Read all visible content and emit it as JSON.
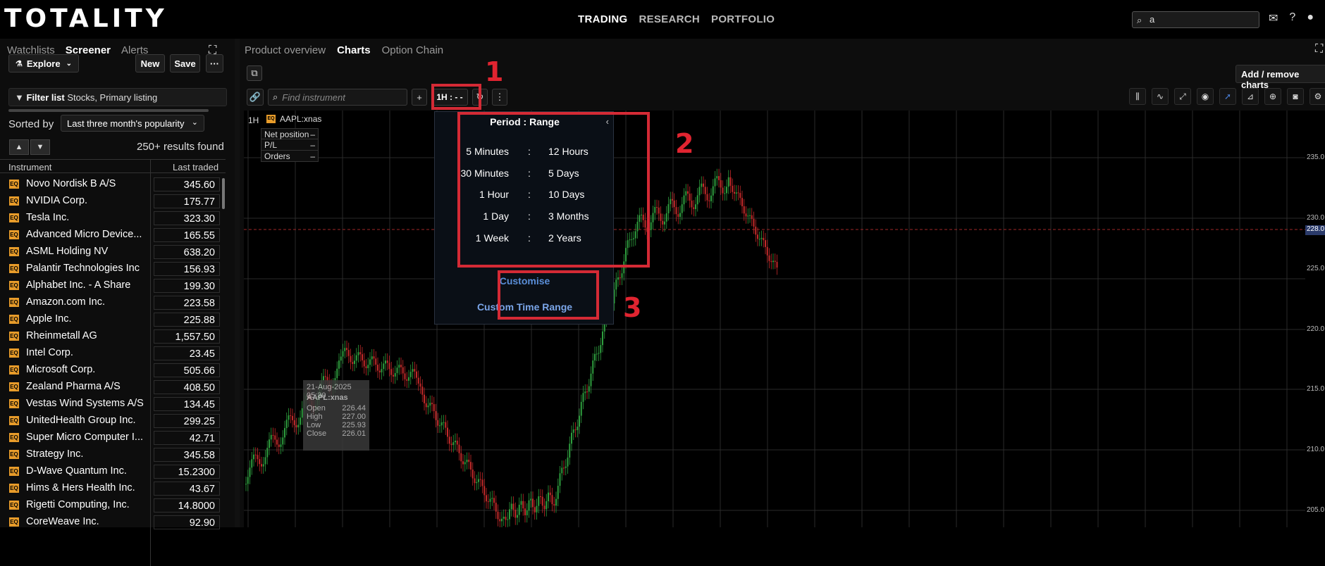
{
  "app": {
    "logo": "TOTALITY"
  },
  "main_nav": [
    {
      "label": "TRADING",
      "active": true
    },
    {
      "label": "RESEARCH",
      "active": false
    },
    {
      "label": "PORTFOLIO",
      "active": false
    }
  ],
  "search": {
    "value": "a"
  },
  "left_panel": {
    "tabs": [
      {
        "label": "Watchlists"
      },
      {
        "label": "Screener",
        "active": true
      },
      {
        "label": "Alerts"
      }
    ],
    "explore": "Explore",
    "new": "New",
    "save": "Save",
    "more": "···",
    "filter_label": "Filter list",
    "filter_value": "Stocks, Primary listing",
    "sorted_by": "Sorted by",
    "sort_option": "Last three month's popularity",
    "results": "250+ results found",
    "col_instrument": "Instrument",
    "col_last": "Last traded",
    "instruments": [
      {
        "name": "Novo Nordisk B A/S",
        "price": "345.60"
      },
      {
        "name": "NVIDIA Corp.",
        "price": "175.77"
      },
      {
        "name": "Tesla Inc.",
        "price": "323.30"
      },
      {
        "name": "Advanced Micro Device...",
        "price": "165.55"
      },
      {
        "name": "ASML Holding NV",
        "price": "638.20"
      },
      {
        "name": "Palantir Technologies Inc",
        "price": "156.93"
      },
      {
        "name": "Alphabet Inc. - A Share",
        "price": "199.30"
      },
      {
        "name": "Amazon.com Inc.",
        "price": "223.58"
      },
      {
        "name": "Apple Inc.",
        "price": "225.88"
      },
      {
        "name": "Rheinmetall AG",
        "price": "1,557.50"
      },
      {
        "name": "Intel Corp.",
        "price": "23.45"
      },
      {
        "name": "Microsoft Corp.",
        "price": "505.66"
      },
      {
        "name": "Zealand Pharma A/S",
        "price": "408.50"
      },
      {
        "name": "Vestas Wind Systems A/S",
        "price": "134.45"
      },
      {
        "name": "UnitedHealth Group Inc.",
        "price": "299.25"
      },
      {
        "name": "Super Micro Computer I...",
        "price": "42.71"
      },
      {
        "name": "Strategy Inc.",
        "price": "345.58"
      },
      {
        "name": "D-Wave Quantum Inc.",
        "price": "15.2300"
      },
      {
        "name": "Hims & Hers Health Inc.",
        "price": "43.67"
      },
      {
        "name": "Rigetti Computing, Inc.",
        "price": "14.8000"
      },
      {
        "name": "CoreWeave Inc.",
        "price": "92.90"
      }
    ]
  },
  "right_panel": {
    "tabs": [
      {
        "label": "Product overview"
      },
      {
        "label": "Charts",
        "active": true
      },
      {
        "label": "Option Chain"
      }
    ],
    "add_remove": "Add / remove charts",
    "find_placeholder": "Find instrument",
    "period_button": "1H : - -",
    "chart": {
      "interval": "1H",
      "symbol": "AAPL:xnas",
      "legend": [
        {
          "label": "Net position",
          "value": "–"
        },
        {
          "label": "P/L",
          "value": "–"
        },
        {
          "label": "Orders",
          "value": "–"
        }
      ],
      "tooltip": {
        "date": "21-Aug-2025 05:30",
        "symbol": "AAPL:xnas",
        "open_label": "Open",
        "open": "226.44",
        "high_label": "High",
        "high": "227.00",
        "low_label": "Low",
        "low": "225.93",
        "close_label": "Close",
        "close": "226.01"
      },
      "y_ticks": [
        "235.0",
        "230.0",
        "228.0",
        "225.0",
        "220.0",
        "215.0",
        "210.0",
        "205.0"
      ],
      "current_price": "228.0"
    }
  },
  "period_dropdown": {
    "title": "Period : Range",
    "close": "‹",
    "options": [
      {
        "period": "5 Minutes",
        "range": "12 Hours"
      },
      {
        "period": "30 Minutes",
        "range": "5 Days"
      },
      {
        "period": "1 Hour",
        "range": "10 Days"
      },
      {
        "period": "1 Day",
        "range": "3 Months"
      },
      {
        "period": "1 Week",
        "range": "2 Years"
      }
    ],
    "customise": "Customise",
    "custom_time_range": "Custom Time Range"
  },
  "annotations": {
    "n1": "1",
    "n2": "2",
    "n3": "3"
  },
  "colors": {
    "accent_blue": "#5a8ed8",
    "annotation_red": "#d42a35",
    "eq_badge": "#e89c2a",
    "bull": "#2e9e3e",
    "bear": "#c42a2a"
  }
}
